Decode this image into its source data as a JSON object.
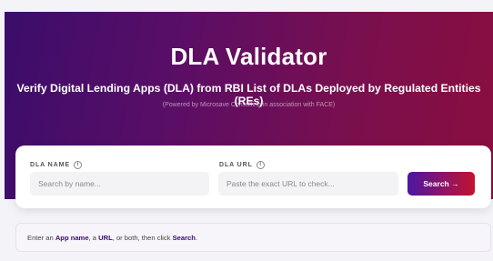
{
  "hero": {
    "title": "DLA Validator",
    "subtitle": "Verify Digital Lending Apps (DLA) from RBI List of DLAs Deployed by Regulated Entities (REs)",
    "powered_by": "(Powered by Microsave Consulting in association with FACE)",
    "gradient_colors": [
      "#3b0d6b",
      "#8a0e3e"
    ]
  },
  "search": {
    "name_label": "DLA NAME",
    "name_placeholder": "Search by name...",
    "url_label": "DLA URL",
    "url_placeholder": "Paste the exact URL to check...",
    "info_glyph": "i",
    "button_label": "Search →",
    "button_colors": [
      "#4b16a3",
      "#c4122f"
    ]
  },
  "hint": {
    "part1": "Enter an ",
    "app_name": "App name",
    "part2": ", a ",
    "url": "URL",
    "part3": ", or both, then click ",
    "search": "Search",
    "part4": "."
  }
}
